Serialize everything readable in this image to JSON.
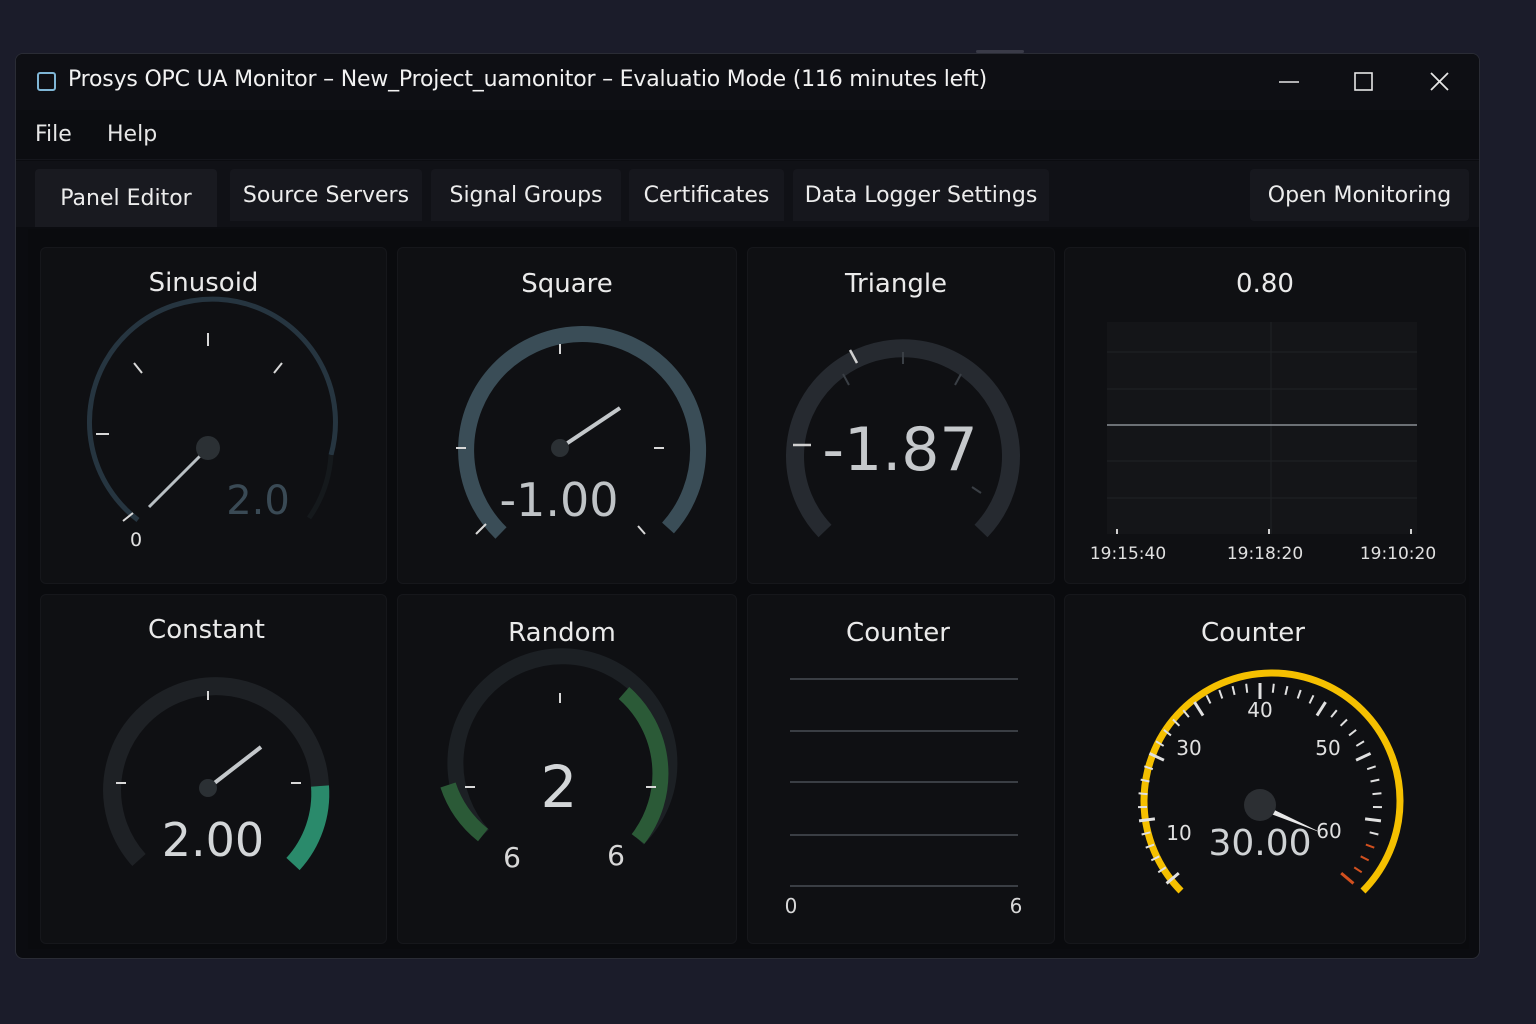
{
  "window": {
    "title": "Prosys OPC UA Monitor – New_Project_uamonitor – Evaluatio Mode (116 minutes left)"
  },
  "menu": {
    "file": "File",
    "help": "Help"
  },
  "tabs": {
    "panel_editor": "Panel Editor",
    "source_servers": "Source Servers",
    "signal_groups": "Signal Groups",
    "certificates": "Certificates",
    "data_logger_settings": "Data Logger Settings",
    "open_monitoring": "Open Monitoring"
  },
  "panels": {
    "sinusoid": {
      "title": "Sinusoid",
      "value": "2.0",
      "min_label": "0"
    },
    "square": {
      "title": "Square",
      "value": "-1.00"
    },
    "triangle": {
      "title": "Triangle",
      "value": "-1.87"
    },
    "trend": {
      "title": "0.80",
      "x_labels": [
        "19:15:40",
        "19:18:20",
        "19:10:20"
      ]
    },
    "constant": {
      "title": "Constant",
      "value": "2.00"
    },
    "random": {
      "title": "Random",
      "value": "2",
      "left_label": "6",
      "right_label": "6"
    },
    "counter_bars": {
      "title": "Counter",
      "x_min": "0",
      "x_max": "6"
    },
    "counter_gauge": {
      "title": "Counter",
      "value": "30.00",
      "scale_labels": [
        "10",
        "30",
        "40",
        "50",
        "60"
      ],
      "needle_value": 60
    }
  },
  "colors": {
    "accent_teal": "#2fa37c",
    "accent_green": "#2f6a3d",
    "gauge_gold": "#f5c000",
    "gauge_red": "#d2501f"
  }
}
